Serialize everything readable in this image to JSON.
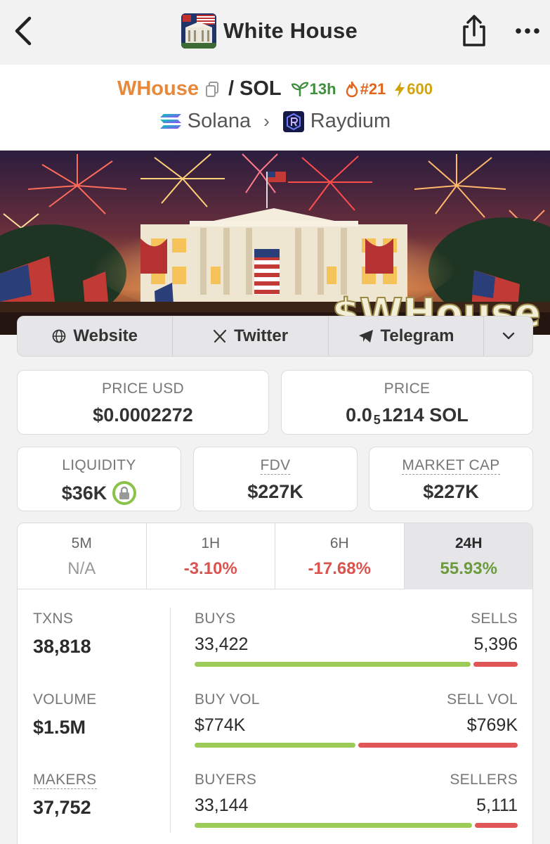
{
  "header": {
    "title": "White House"
  },
  "pair": {
    "symbol": "WHouse",
    "separator": "/",
    "quote": "SOL",
    "age": "13h",
    "rank": "#21",
    "boosts": "600",
    "chain": "Solana",
    "dex": "Raydium"
  },
  "banner": {
    "text": "$WHouse"
  },
  "links": {
    "website": "Website",
    "twitter": "Twitter",
    "telegram": "Telegram"
  },
  "prices": {
    "price_usd_label": "PRICE USD",
    "price_usd": "$0.0002272",
    "price_label": "PRICE",
    "price_prefix": "0.0",
    "price_zeros": "5",
    "price_suffix": "1214 SOL"
  },
  "metrics": {
    "liquidity_label": "LIQUIDITY",
    "liquidity": "$36K",
    "fdv_label": "FDV",
    "fdv": "$227K",
    "mcap_label": "MARKET CAP",
    "mcap": "$227K"
  },
  "timeframes": [
    {
      "label": "5M",
      "change": "N/A"
    },
    {
      "label": "1H",
      "change": "-3.10%"
    },
    {
      "label": "6H",
      "change": "-17.68%"
    },
    {
      "label": "24H",
      "change": "55.93%"
    }
  ],
  "stats": {
    "txns_label": "TXNS",
    "txns": "38,818",
    "volume_label": "VOLUME",
    "volume": "$1.5M",
    "makers_label": "MAKERS",
    "makers": "37,752",
    "buys_label": "BUYS",
    "buys": "33,422",
    "sells_label": "SELLS",
    "sells": "5,396",
    "buy_vol_label": "BUY VOL",
    "buy_vol": "$774K",
    "sell_vol_label": "SELL VOL",
    "sell_vol": "$769K",
    "buyers_label": "BUYERS",
    "buyers": "33,144",
    "sellers_label": "SELLERS",
    "sellers": "5,111",
    "buys_ratio": 0.861,
    "buy_vol_ratio": 0.502,
    "buyers_ratio": 0.866
  },
  "colors": {
    "accent": "#e8893a",
    "positive": "#6b9b3c",
    "negative": "#d9534f",
    "buy_bar": "#9ccc57",
    "sell_bar": "#e05656"
  }
}
